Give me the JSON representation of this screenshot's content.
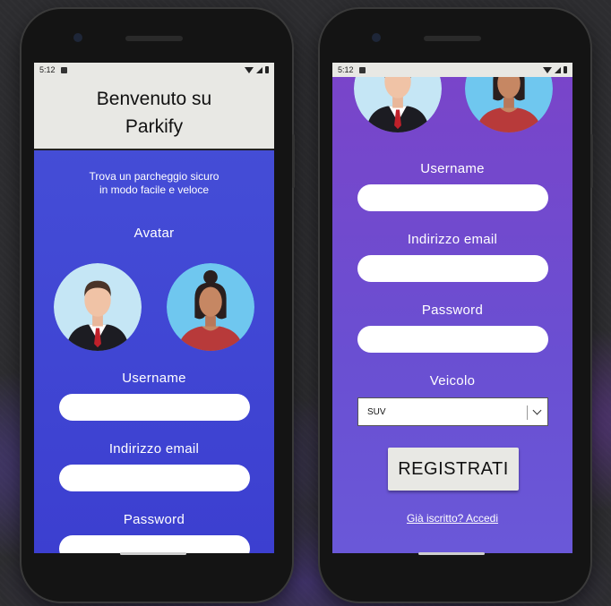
{
  "status": {
    "time": "5:12"
  },
  "left_screen": {
    "title": "Benvenuto su Parkify",
    "tagline_line1": "Trova un parcheggio sicuro",
    "tagline_line2": "in modo facile e veloce",
    "avatar_label": "Avatar",
    "username_label": "Username",
    "email_label": "Indirizzo email",
    "password_label": "Password"
  },
  "right_screen": {
    "username_label": "Username",
    "email_label": "Indirizzo email",
    "password_label": "Password",
    "vehicle_label": "Veicolo",
    "vehicle_selected": "SUV",
    "register_button": "REGISTRATI",
    "login_link": "Già iscritto? Accedi"
  },
  "colors": {
    "left_bg": "#4650d8",
    "right_bg": "#7a44c9",
    "header_bg": "#e8e8e4",
    "button_bg": "#e8e8e4"
  }
}
